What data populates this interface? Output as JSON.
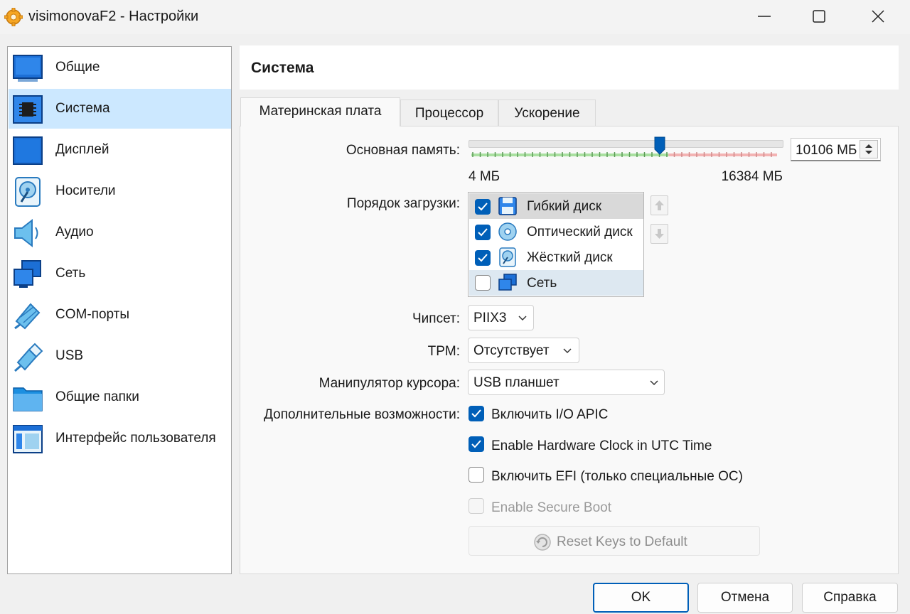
{
  "window": {
    "title": "visimonovaF2 - Настройки"
  },
  "sidebar": {
    "items": [
      {
        "label": "Общие",
        "icon": "general-icon"
      },
      {
        "label": "Система",
        "icon": "system-chip-icon",
        "selected": true
      },
      {
        "label": "Дисплей",
        "icon": "display-icon"
      },
      {
        "label": "Носители",
        "icon": "storage-disk-icon"
      },
      {
        "label": "Аудио",
        "icon": "speaker-icon"
      },
      {
        "label": "Сеть",
        "icon": "network-icon"
      },
      {
        "label": "COM-порты",
        "icon": "serial-cable-icon"
      },
      {
        "label": "USB",
        "icon": "usb-icon"
      },
      {
        "label": "Общие папки",
        "icon": "folder-icon"
      },
      {
        "label": "Интерфейс пользователя",
        "icon": "user-interface-icon"
      }
    ]
  },
  "page": {
    "title": "Система"
  },
  "tabs": [
    {
      "label": "Материнская плата",
      "active": true
    },
    {
      "label": "Процессор"
    },
    {
      "label": "Ускорение"
    }
  ],
  "motherboard": {
    "memory": {
      "label": "Основная память:",
      "value": "10106 МБ",
      "min": "4 МБ",
      "max": "16384 МБ",
      "level_fraction": 0.617
    },
    "boot_order": {
      "label": "Порядок загрузки:",
      "items": [
        {
          "label": "Гибкий диск",
          "checked": true,
          "icon": "floppy-icon"
        },
        {
          "label": "Оптический диск",
          "checked": true,
          "icon": "optical-disc-icon"
        },
        {
          "label": "Жёсткий диск",
          "checked": true,
          "icon": "hard-disk-icon"
        },
        {
          "label": "Сеть",
          "checked": false,
          "icon": "network-icon"
        }
      ]
    },
    "chipset": {
      "label": "Чипсет:",
      "value": "PIIX3"
    },
    "tpm": {
      "label": "TPM:",
      "value": "Отсутствует"
    },
    "pointer": {
      "label": "Манипулятор курсора:",
      "value": "USB планшет"
    },
    "features": {
      "label": "Дополнительные возможности:",
      "io_apic": {
        "label": "Включить I/O APIC",
        "checked": true
      },
      "utc": {
        "label": "Enable Hardware Clock in UTC Time",
        "checked": true
      },
      "efi": {
        "label": "Включить EFI (только специальные ОС)",
        "checked": false
      },
      "secure_boot": {
        "label": "Enable Secure Boot",
        "checked": false,
        "disabled": true
      }
    },
    "reset_keys": {
      "label": "Reset Keys to Default"
    }
  },
  "buttons": {
    "ok": "OK",
    "cancel": "Отмена",
    "help": "Справка"
  },
  "colors": {
    "accent": "#005fb8",
    "selection": "#cce8ff"
  }
}
